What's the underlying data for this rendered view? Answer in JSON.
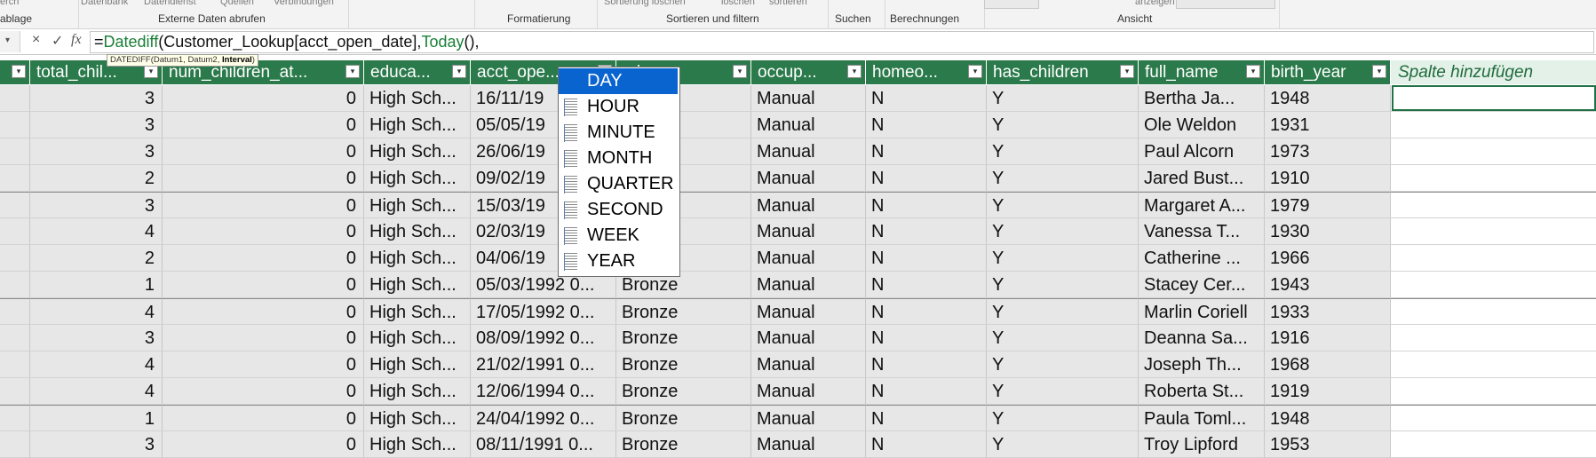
{
  "ribbon": {
    "cut_labels": [
      "erch",
      "Datenbank",
      "Datendienst",
      "Quellen",
      "Verbindungen",
      "Sortierung löschen",
      "löschen",
      "sortieren",
      "anzeigen"
    ],
    "group_labels": [
      "ablage",
      "Externe Daten abrufen",
      "Formatierung",
      "Sortieren und filtern",
      "Suchen",
      "Berechnungen",
      "Ansicht"
    ]
  },
  "formula_bar": {
    "cancel_symbol": "×",
    "confirm_symbol": "✓",
    "fx_symbol": "fx",
    "formula_parts": [
      "=",
      "Datediff",
      "(Customer_Lookup[acct_open_date],",
      "Today",
      "(),"
    ],
    "tooltip_prefix": "DATEDIFF(Datum1, Datum2, ",
    "tooltip_bold": "Interval",
    "tooltip_suffix": ")"
  },
  "columns": [
    {
      "label": "",
      "filter": true
    },
    {
      "label": "total_chil...",
      "filter": true
    },
    {
      "label": "num_children_at...",
      "filter": true
    },
    {
      "label": "educa...",
      "filter": true
    },
    {
      "label": "acct_ope...",
      "filter": true
    },
    {
      "label": "...ber...",
      "filter": true
    },
    {
      "label": "occup...",
      "filter": true
    },
    {
      "label": "homeo...",
      "filter": true
    },
    {
      "label": "has_children",
      "filter": true
    },
    {
      "label": "full_name",
      "filter": true
    },
    {
      "label": "birth_year",
      "filter": true
    }
  ],
  "add_column_label": "Spalte hinzufügen",
  "rows": [
    [
      "3",
      "0",
      "High Sch...",
      "16/11/19",
      "Bronze",
      "Manual",
      "N",
      "Y",
      "Bertha Ja...",
      "1948"
    ],
    [
      "3",
      "0",
      "High Sch...",
      "05/05/19",
      "Bronze",
      "Manual",
      "N",
      "Y",
      "Ole Weldon",
      "1931"
    ],
    [
      "3",
      "0",
      "High Sch...",
      "26/06/19",
      "Bronze",
      "Manual",
      "N",
      "Y",
      "Paul Alcorn",
      "1973"
    ],
    [
      "2",
      "0",
      "High Sch...",
      "09/02/19",
      "Bronze",
      "Manual",
      "N",
      "Y",
      "Jared Bust...",
      "1910"
    ],
    [
      "3",
      "0",
      "High Sch...",
      "15/03/19",
      "Bronze",
      "Manual",
      "N",
      "Y",
      "Margaret A...",
      "1979"
    ],
    [
      "4",
      "0",
      "High Sch...",
      "02/03/19",
      "Bronze",
      "Manual",
      "N",
      "Y",
      "Vanessa T...",
      "1930"
    ],
    [
      "2",
      "0",
      "High Sch...",
      "04/06/19",
      "Bronze",
      "Manual",
      "N",
      "Y",
      "Catherine ...",
      "1966"
    ],
    [
      "1",
      "0",
      "High Sch...",
      "05/03/1992 0...",
      "Bronze",
      "Manual",
      "N",
      "Y",
      "Stacey Cer...",
      "1943"
    ],
    [
      "4",
      "0",
      "High Sch...",
      "17/05/1992 0...",
      "Bronze",
      "Manual",
      "N",
      "Y",
      "Marlin Coriell",
      "1933"
    ],
    [
      "3",
      "0",
      "High Sch...",
      "08/09/1992 0...",
      "Bronze",
      "Manual",
      "N",
      "Y",
      "Deanna Sa...",
      "1916"
    ],
    [
      "4",
      "0",
      "High Sch...",
      "21/02/1991 0...",
      "Bronze",
      "Manual",
      "N",
      "Y",
      "Joseph Th...",
      "1968"
    ],
    [
      "4",
      "0",
      "High Sch...",
      "12/06/1994 0...",
      "Bronze",
      "Manual",
      "N",
      "Y",
      "Roberta St...",
      "1919"
    ],
    [
      "1",
      "0",
      "High Sch...",
      "24/04/1992 0...",
      "Bronze",
      "Manual",
      "N",
      "Y",
      "Paula Toml...",
      "1948"
    ],
    [
      "3",
      "0",
      "High Sch...",
      "08/11/1991 0...",
      "Bronze",
      "Manual",
      "N",
      "Y",
      "Troy Lipford",
      "1953"
    ]
  ],
  "autocomplete": {
    "items": [
      "DAY",
      "HOUR",
      "MINUTE",
      "MONTH",
      "QUARTER",
      "SECOND",
      "WEEK",
      "YEAR"
    ],
    "selected": "DAY"
  },
  "colors": {
    "header_bg": "#2b7a4b",
    "add_column_text": "#1f6b3d",
    "selection": "#0a64d0",
    "formula_function": "#1a7f37"
  }
}
